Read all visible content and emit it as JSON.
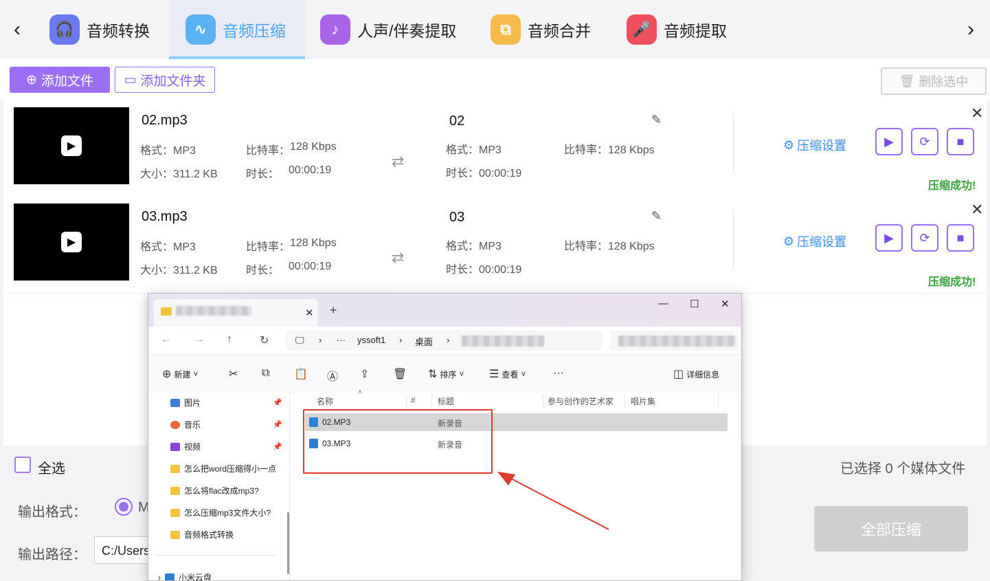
{
  "tabs": [
    {
      "label": "音频转换",
      "icon": "headphones-icon",
      "color": "#6a79f0"
    },
    {
      "label": "音频压缩",
      "icon": "waveform-icon",
      "color": "#5ab2f5"
    },
    {
      "label": "人声/伴奏提取",
      "icon": "vocal-icon",
      "color": "#a964e8"
    },
    {
      "label": "音频合并",
      "icon": "merge-icon",
      "color": "#f6b94a"
    },
    {
      "label": "音频提取",
      "icon": "microphone-icon",
      "color": "#f0505e"
    }
  ],
  "toolbar": {
    "add_file": "添加文件",
    "add_folder": "添加文件夹",
    "delete_selected": "删除选中"
  },
  "files": [
    {
      "name": "02.mp3",
      "format": "格式：MP3",
      "bitrate_label": "比特率：",
      "bitrate": "128 Kbps",
      "size": "大小：311.2 KB",
      "duration_label": "时长：",
      "duration": "00:00:19",
      "out_name": "02",
      "out_format": "格式：MP3",
      "out_bitrate": "比特率：128 Kbps",
      "out_duration": "时长：00:00:19",
      "settings": "压缩设置",
      "status": "压缩成功!"
    },
    {
      "name": "03.mp3",
      "format": "格式：MP3",
      "bitrate_label": "比特率：",
      "bitrate": "128 Kbps",
      "size": "大小：311.2 KB",
      "duration_label": "时长：",
      "duration": "00:00:19",
      "out_name": "03",
      "out_format": "格式：MP3",
      "out_bitrate": "比特率：128 Kbps",
      "out_duration": "时长：00:00:19",
      "settings": "压缩设置",
      "status": "压缩成功!"
    }
  ],
  "bottom": {
    "select_all": "全选",
    "selected_info": "已选择 0 个媒体文件",
    "output_format_label": "输出格式：",
    "output_format_value": "M",
    "output_path_label": "输出路径：",
    "output_path_value": "C:/Users",
    "compress_all": "全部压缩"
  },
  "explorer": {
    "breadcrumbs": [
      "yssoft1",
      "桌面"
    ],
    "commands": {
      "new": "新建",
      "sort": "排序",
      "view": "查看",
      "details": "详细信息"
    },
    "nav_items": [
      {
        "label": "图片",
        "pinned": true,
        "color": "#3d7fd8"
      },
      {
        "label": "音乐",
        "pinned": true,
        "color": "#e86a3a"
      },
      {
        "label": "视频",
        "pinned": true,
        "color": "#8a44d8"
      },
      {
        "label": "怎么把word压缩得小一点",
        "pinned": false,
        "color": "#f3c43e"
      },
      {
        "label": "怎么将flac改成mp3?",
        "pinned": false,
        "color": "#f3c43e"
      },
      {
        "label": "怎么压缩mp3文件大小?",
        "pinned": false,
        "color": "#f3c43e"
      },
      {
        "label": "音频格式转换",
        "pinned": false,
        "color": "#f3c43e"
      },
      {
        "label": "小米云盘",
        "pinned": false,
        "color": "#2f7fd6"
      }
    ],
    "columns": [
      "名称",
      "#",
      "标题",
      "参与创作的艺术家",
      "唱片集"
    ],
    "files": [
      {
        "name": "02.MP3",
        "title": "新录音"
      },
      {
        "name": "03.MP3",
        "title": "新录音"
      }
    ]
  }
}
